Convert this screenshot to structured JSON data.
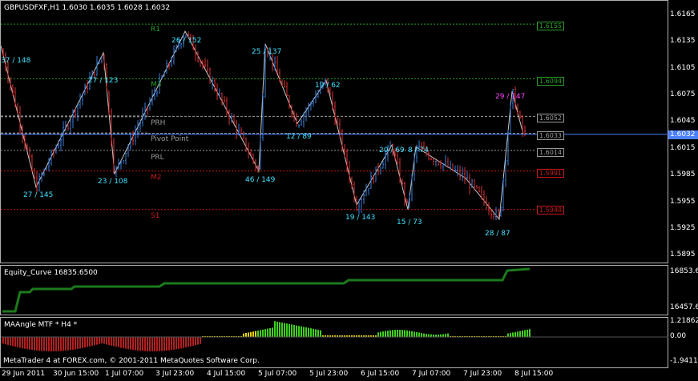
{
  "main": {
    "title": "GBPUSDFXF,H1  1.6030 1.6035 1.6028 1.6032",
    "price_axis": [
      "1.6165",
      "1.6135",
      "1.6105",
      "1.6075",
      "1.6045",
      "1.6015",
      "1.5985",
      "1.5955",
      "1.5925",
      "1.5895"
    ],
    "current_price": "1.6032",
    "levels": {
      "r1": {
        "label": "R1",
        "value": "1.6155",
        "color": "#2aa02a"
      },
      "m3": {
        "label": "M3",
        "value": "1.6094",
        "color": "#2aa02a"
      },
      "prh": {
        "label": "PRH",
        "value": "1.6052",
        "color": "#9a9a9a"
      },
      "pivot": {
        "label": "Pivot Point",
        "value": "1.6033",
        "color": "#9a9a9a"
      },
      "prl": {
        "label": "PRL",
        "value": "1.6014",
        "color": "#9a9a9a"
      },
      "m2": {
        "label": "M2",
        "value": "1.5991",
        "color": "#c81818"
      },
      "s1": {
        "label": "S1",
        "value": "1.5948",
        "color": "#c81818"
      }
    },
    "zigzag_labels": [
      {
        "text": "37 / 148",
        "color": "#40e0ff"
      },
      {
        "text": "27 / 145",
        "color": "#40e0ff"
      },
      {
        "text": "27 / 123",
        "color": "#40e0ff"
      },
      {
        "text": "23 / 108",
        "color": "#40e0ff"
      },
      {
        "text": "26 / 152",
        "color": "#40e0ff"
      },
      {
        "text": "46 / 149",
        "color": "#40e0ff"
      },
      {
        "text": "25 / 137",
        "color": "#40e0ff"
      },
      {
        "text": "12 / 89",
        "color": "#40e0ff"
      },
      {
        "text": "19 / 62",
        "color": "#40e0ff"
      },
      {
        "text": "19 / 143",
        "color": "#40e0ff"
      },
      {
        "text": "20 / 69",
        "color": "#40e0ff"
      },
      {
        "text": "8 / 74",
        "color": "#40e0ff"
      },
      {
        "text": "15 / 73",
        "color": "#40e0ff"
      },
      {
        "text": "28 / 87",
        "color": "#40e0ff"
      },
      {
        "text": "29 / 147",
        "color": "#ff40ff"
      }
    ]
  },
  "equity": {
    "title": "Equity_Curve 16835.6500",
    "axis": [
      "16853.6",
      "16457.6"
    ],
    "color": "#1c7a1c"
  },
  "maangle": {
    "title": "MAAngle MTF * H4 *",
    "axis": [
      "1.21862",
      "0.00",
      "-1.94112"
    ],
    "colors": {
      "down": "#b02020",
      "flat": "#e8d000",
      "up": "#40d020"
    }
  },
  "footer": {
    "copyright": "MetaTrader 4 at FOREX.com, © 2001-2011 MetaQuotes Software Corp."
  },
  "time_axis": [
    "29 Jun 2011",
    "30 Jun 15:00",
    "1 Jul 07:00",
    "3 Jul 23:00",
    "4 Jul 15:00",
    "5 Jul 07:00",
    "5 Jul 23:00",
    "6 Jul 15:00",
    "7 Jul 07:00",
    "7 Jul 23:00",
    "8 Jul 15:00"
  ],
  "colors": {
    "bull": "#3a7bd5",
    "bear": "#d83030",
    "zigzag": "#c8c8c8",
    "price_line": "#4a80ff"
  }
}
